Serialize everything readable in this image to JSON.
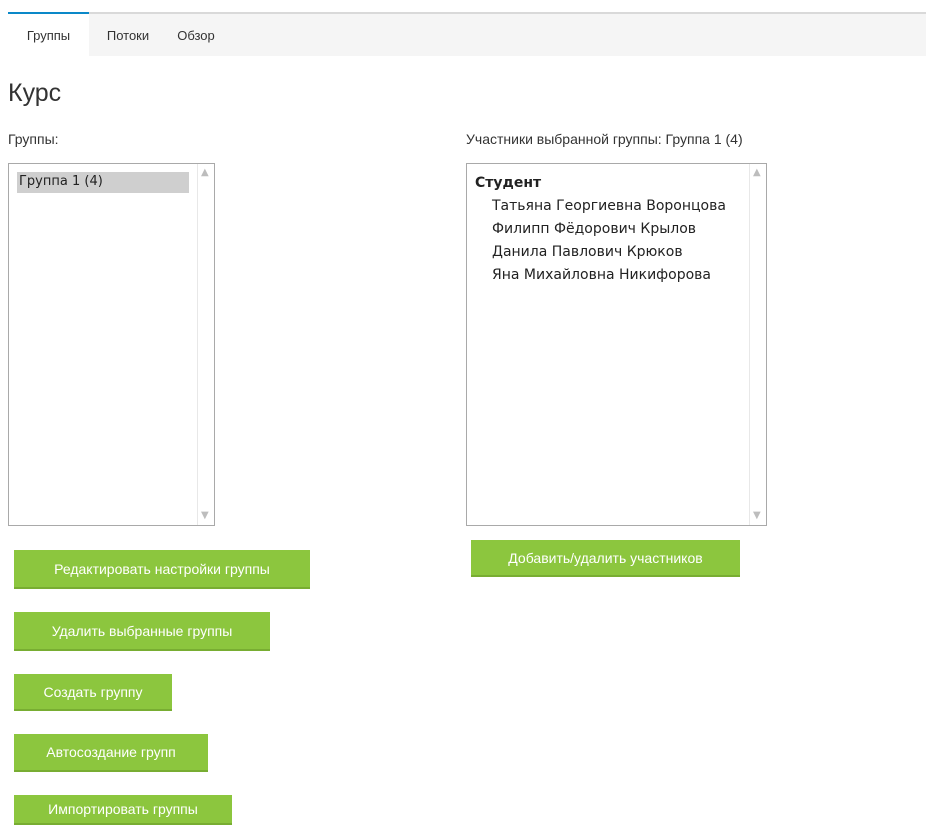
{
  "tabs": [
    "Группы",
    "Потоки",
    "Обзор"
  ],
  "active_tab": "Группы",
  "page_title": "Курс",
  "groups_panel": {
    "label": "Группы:",
    "options": [
      "Группа 1 (4)"
    ],
    "selected": "Группа 1 (4)"
  },
  "members_panel": {
    "label": "Участники выбранной группы: Группа 1 (4)",
    "role": "Студент",
    "members": [
      "Татьяна Георгиевна Воронцова",
      "Филипп Фёдорович Крылов",
      "Данила Павлович Крюков",
      "Яна Михайловна Никифорова"
    ]
  },
  "buttons": {
    "edit_group": "Редактировать настройки группы",
    "delete_groups": "Удалить выбранные группы",
    "create_group": "Создать группу",
    "auto_create": "Автосоздание групп",
    "import_groups": "Импортировать группы",
    "add_remove_members": "Добавить/удалить участников"
  },
  "colors": {
    "button_bg": "#8cc63e",
    "tab_active_border": "#0a88c8",
    "selection_bg": "#cfcfcf"
  }
}
